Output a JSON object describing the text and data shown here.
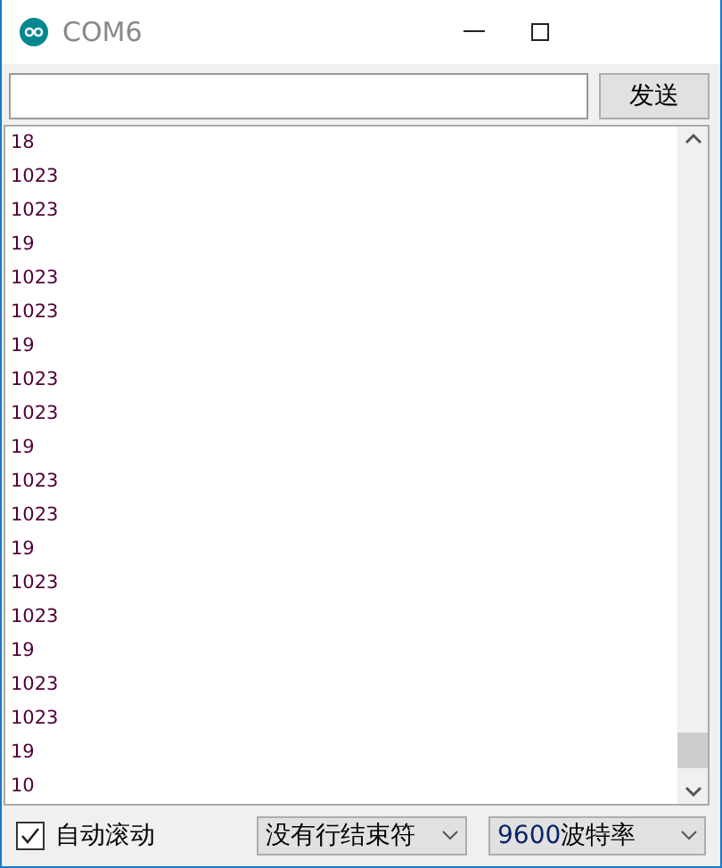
{
  "window": {
    "title": "COM6"
  },
  "send": {
    "button": "发送"
  },
  "output": {
    "lines": [
      "18",
      "1023",
      "1023",
      "19",
      "1023",
      "1023",
      "19",
      "1023",
      "1023",
      "19",
      "1023",
      "1023",
      "19",
      "1023",
      "1023",
      "19",
      "1023",
      "1023",
      "19",
      "10"
    ]
  },
  "footer": {
    "autoscroll": {
      "label": "自动滚动",
      "checked": true
    },
    "line_ending": "没有行结束符",
    "baud": {
      "number": "9600",
      "unit": "波特率"
    }
  }
}
